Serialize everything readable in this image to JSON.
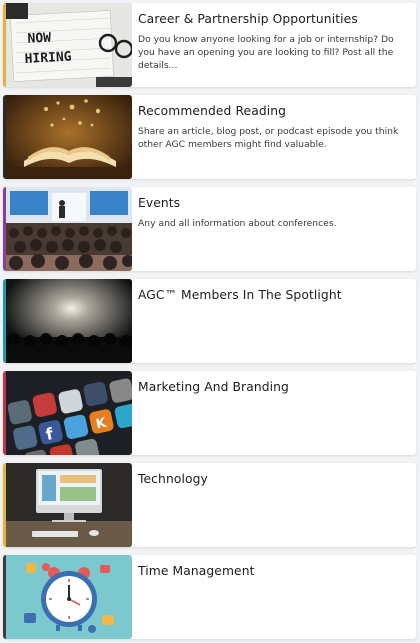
{
  "categories": [
    {
      "title": "Career & Partnership Opportunities",
      "description": "Do you know anyone looking for a job or internship? Do you have an opening you are looking to fill? Post all the details...",
      "accent": "#e0b43a",
      "thumbnail": "now-hiring-photo",
      "thumbnail_text": [
        "NOW",
        "HIRING"
      ]
    },
    {
      "title": "Recommended Reading",
      "description": "Share an article, blog post, or podcast episode you think other AGC members might find valuable.",
      "accent": "#2a2a2a",
      "thumbnail": "open-book-photo"
    },
    {
      "title": "Events",
      "description": "Any and all information about conferences.",
      "accent": "#8a3ea0",
      "thumbnail": "conference-audience-photo"
    },
    {
      "title": "AGC™ Members In The Spotlight",
      "description": "",
      "accent": "#1f9aa8",
      "thumbnail": "spotlight-stage-photo"
    },
    {
      "title": "Marketing And Branding",
      "description": "",
      "accent": "#c0344a",
      "thumbnail": "social-media-apps-photo"
    },
    {
      "title": "Technology",
      "description": "",
      "accent": "#e0b43a",
      "thumbnail": "desktop-computer-photo"
    },
    {
      "title": "Time Management",
      "description": "",
      "accent": "#3d3d3d",
      "thumbnail": "alarm-clock-illustration"
    }
  ]
}
